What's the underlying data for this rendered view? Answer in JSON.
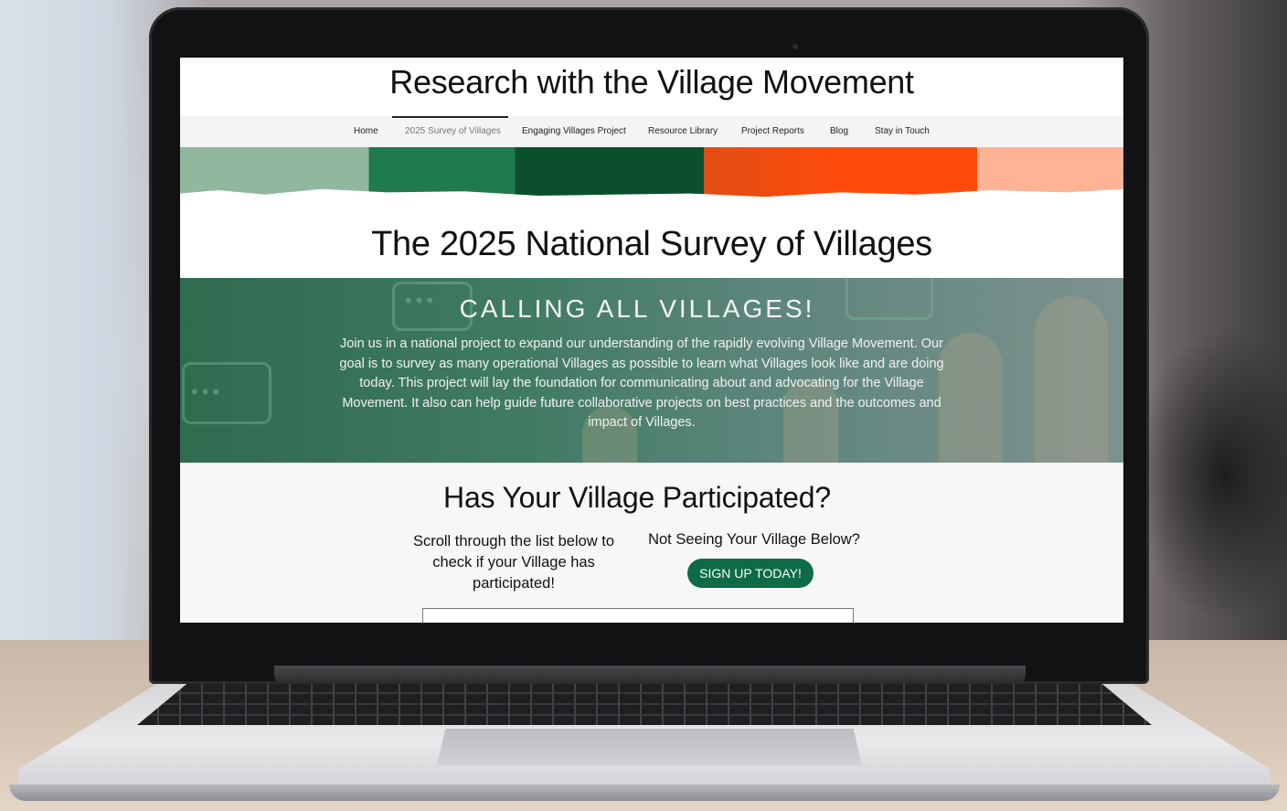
{
  "site": {
    "title": "Research with the Village Movement"
  },
  "nav": {
    "items": [
      {
        "label": "Home"
      },
      {
        "label": "2025 Survey of Villages",
        "active": true
      },
      {
        "label": "Engaging Villages Project"
      },
      {
        "label": "Resource Library"
      },
      {
        "label": "Project Reports"
      },
      {
        "label": "Blog"
      },
      {
        "label": "Stay in Touch"
      }
    ]
  },
  "banner": {
    "colors": [
      "#8fb89f",
      "#1f7a4c",
      "#0c4f2c",
      "#ff4b0a",
      "#fdb394"
    ]
  },
  "page": {
    "heading": "The 2025 National Survey of Villages"
  },
  "hero": {
    "title": "CALLING ALL VILLAGES!",
    "body": "Join us in a national project to expand our understanding of the rapidly evolving Village Movement. Our goal is to survey as many operational Villages as possible to learn what Villages look like and are doing today. This project will lay the foundation for communicating about and advocating for the Village Movement. It also can help guide future collaborative projects on best practices and the outcomes and impact of Villages."
  },
  "participate": {
    "title": "Has Your Village Participated?",
    "left_text": "Scroll through the list below to check if your Village has participated!",
    "right_label": "Not Seeing Your Village Below?",
    "signup_label": "SIGN UP TODAY!",
    "button_color": "#0d6b45"
  }
}
